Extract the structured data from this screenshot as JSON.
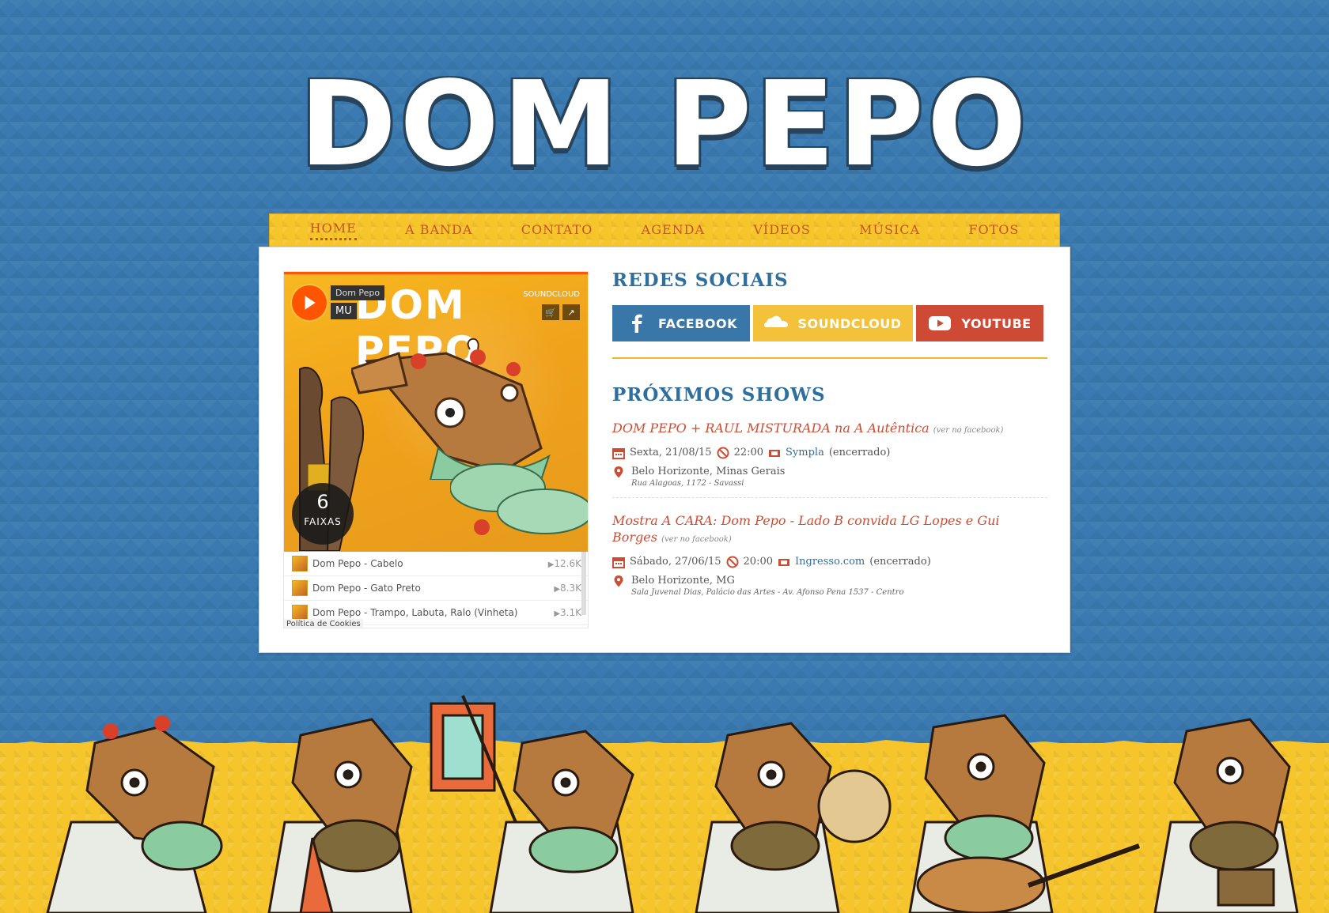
{
  "site": {
    "logo_text": "DOM PEPO"
  },
  "nav": {
    "items": [
      {
        "label": "HOME",
        "active": true
      },
      {
        "label": "A BANDA",
        "active": false
      },
      {
        "label": "CONTATO",
        "active": false
      },
      {
        "label": "AGENDA",
        "active": false
      },
      {
        "label": "VÍDEOS",
        "active": false
      },
      {
        "label": "MÚSICA",
        "active": false
      },
      {
        "label": "FOTOS",
        "active": false
      }
    ]
  },
  "soundcloud": {
    "user": "Dom Pepo",
    "track_label": "MU",
    "brand": "SOUNDCLOUD",
    "art_title": "DOM PEPO",
    "tracks_count": "6",
    "tracks_label": "FAIXAS",
    "tracks": [
      {
        "title": "Dom Pepo - Cabelo",
        "plays": "12.6K"
      },
      {
        "title": "Dom Pepo - Gato Preto",
        "plays": "8.3K"
      },
      {
        "title": "Dom Pepo - Trampo, Labuta, Ralo (Vinheta)",
        "plays": "3.1K"
      }
    ],
    "cookie_label": "Política de Cookies",
    "colors": {
      "accent": "#ff5500"
    }
  },
  "social": {
    "title": "REDES SOCIAIS",
    "buttons": [
      {
        "label": "FACEBOOK",
        "icon": "facebook-icon",
        "color": "#3977a8"
      },
      {
        "label": "SOUNDCLOUD",
        "icon": "soundcloud-icon",
        "color": "#f3c23a"
      },
      {
        "label": "YOUTUBE",
        "icon": "youtube-icon",
        "color": "#cf4a35"
      }
    ]
  },
  "shows": {
    "title": "PRÓXIMOS SHOWS",
    "items": [
      {
        "title": "DOM PEPO + RAUL MISTURADA na A Autêntica",
        "fb_note": "(ver no facebook)",
        "date": "Sexta, 21/08/15",
        "time": "22:00",
        "ticket_link": "Sympla",
        "ticket_status": "(encerrado)",
        "city": "Belo Horizonte, Minas Gerais",
        "address": "Rua Alagoas, 1172 - Savassi"
      },
      {
        "title": "Mostra A CARA: Dom Pepo - Lado B convida LG Lopes e Gui Borges",
        "fb_note": "(ver no facebook)",
        "date": "Sábado, 27/06/15",
        "time": "20:00",
        "ticket_link": "Ingresso.com",
        "ticket_status": "(encerrado)",
        "city": "Belo Horizonte, MG",
        "address": "Sala Juvenal Dias, Palácio das Artes - Av. Afonso Pena 1537 - Centro"
      }
    ]
  }
}
